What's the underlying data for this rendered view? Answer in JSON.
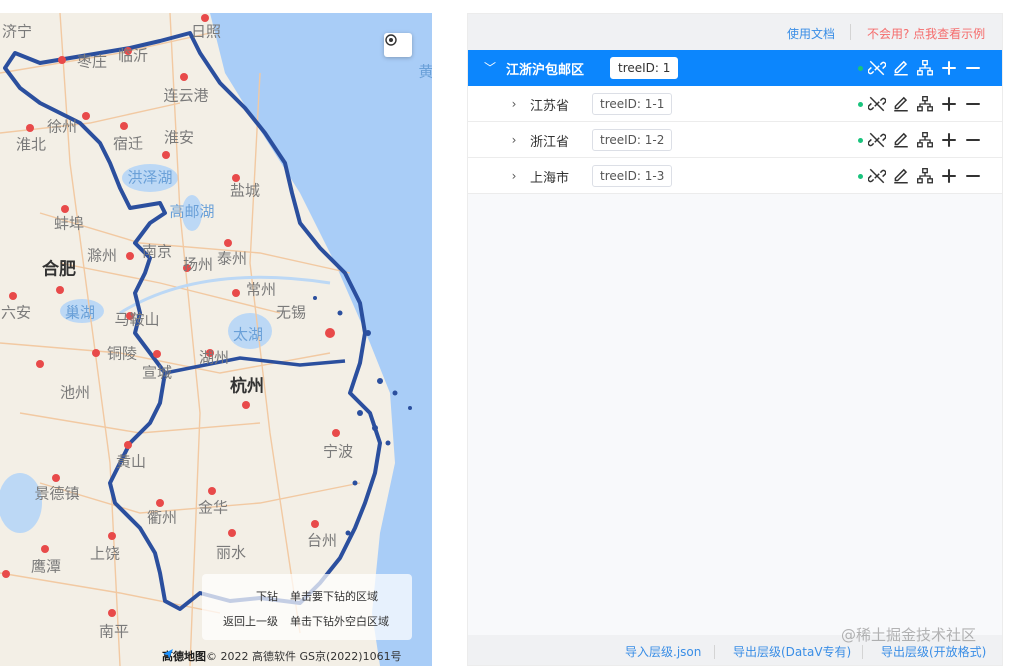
{
  "map": {
    "attribution_logo": "高德地图",
    "attribution": "© 2022 高德软件 GS京(2022)1061号",
    "hint": {
      "drill_key": "下钻",
      "drill_val": "单击要下钻的区域",
      "up_key": "返回上一级",
      "up_val": "单击下钻外空白区域"
    },
    "cities": [
      {
        "name": "济宁",
        "cls": ""
      },
      {
        "name": "日照",
        "cls": ""
      },
      {
        "name": "枣庄",
        "cls": ""
      },
      {
        "name": "临沂",
        "cls": ""
      },
      {
        "name": "徐州",
        "cls": ""
      },
      {
        "name": "连云港",
        "cls": ""
      },
      {
        "name": "淮北",
        "cls": ""
      },
      {
        "name": "宿迁",
        "cls": ""
      },
      {
        "name": "淮安",
        "cls": ""
      },
      {
        "name": "洪泽湖",
        "cls": "water"
      },
      {
        "name": "盐城",
        "cls": ""
      },
      {
        "name": "蚌埠",
        "cls": ""
      },
      {
        "name": "高邮湖",
        "cls": "water"
      },
      {
        "name": "滁州",
        "cls": ""
      },
      {
        "name": "南京",
        "cls": ""
      },
      {
        "name": "扬州",
        "cls": ""
      },
      {
        "name": "泰州",
        "cls": ""
      },
      {
        "name": "合肥",
        "cls": "big"
      },
      {
        "name": "六安",
        "cls": ""
      },
      {
        "name": "巢湖",
        "cls": "water"
      },
      {
        "name": "马鞍山",
        "cls": ""
      },
      {
        "name": "常州",
        "cls": ""
      },
      {
        "name": "无锡",
        "cls": ""
      },
      {
        "name": "太湖",
        "cls": "water"
      },
      {
        "name": "铜陵",
        "cls": ""
      },
      {
        "name": "宣城",
        "cls": ""
      },
      {
        "name": "湖州",
        "cls": ""
      },
      {
        "name": "杭州",
        "cls": ""
      },
      {
        "name": "池州",
        "cls": ""
      },
      {
        "name": "黄山",
        "cls": ""
      },
      {
        "name": "宁波",
        "cls": ""
      },
      {
        "name": "景德镇",
        "cls": ""
      },
      {
        "name": "衢州",
        "cls": ""
      },
      {
        "name": "金华",
        "cls": ""
      },
      {
        "name": "丽水",
        "cls": ""
      },
      {
        "name": "上饶",
        "cls": ""
      },
      {
        "name": "鹰潭",
        "cls": ""
      },
      {
        "name": "台州",
        "cls": ""
      },
      {
        "name": "南平",
        "cls": ""
      },
      {
        "name": "黄",
        "cls": "water"
      }
    ]
  },
  "panel": {
    "doc_link": "使用文档",
    "demo_link": "不会用? 点我查看示例",
    "tree": [
      {
        "label": "江浙沪包邮区",
        "tag": "treeID: 1",
        "root": true,
        "chevron": "﹀"
      },
      {
        "label": "江苏省",
        "tag": "treeID: 1-1",
        "root": false,
        "chevron": "›"
      },
      {
        "label": "浙江省",
        "tag": "treeID: 1-2",
        "root": false,
        "chevron": "›"
      },
      {
        "label": "上海市",
        "tag": "treeID: 1-3",
        "root": false,
        "chevron": "›"
      }
    ],
    "actions": [
      "unlink-icon",
      "edit-icon",
      "hierarchy-icon",
      "plus-icon",
      "minus-icon"
    ],
    "bottom": {
      "import": "导入层级.json",
      "export_datav": "导出层级(DataV专有)",
      "export_open": "导出层级(开放格式)"
    }
  },
  "watermark": "@稀土掘金技术社区",
  "colors": {
    "accent": "#0c86fd",
    "boundary": "#2b4f9e",
    "link": "#3a8ee6",
    "warn": "#f56c6c",
    "status": "#19c37d"
  }
}
